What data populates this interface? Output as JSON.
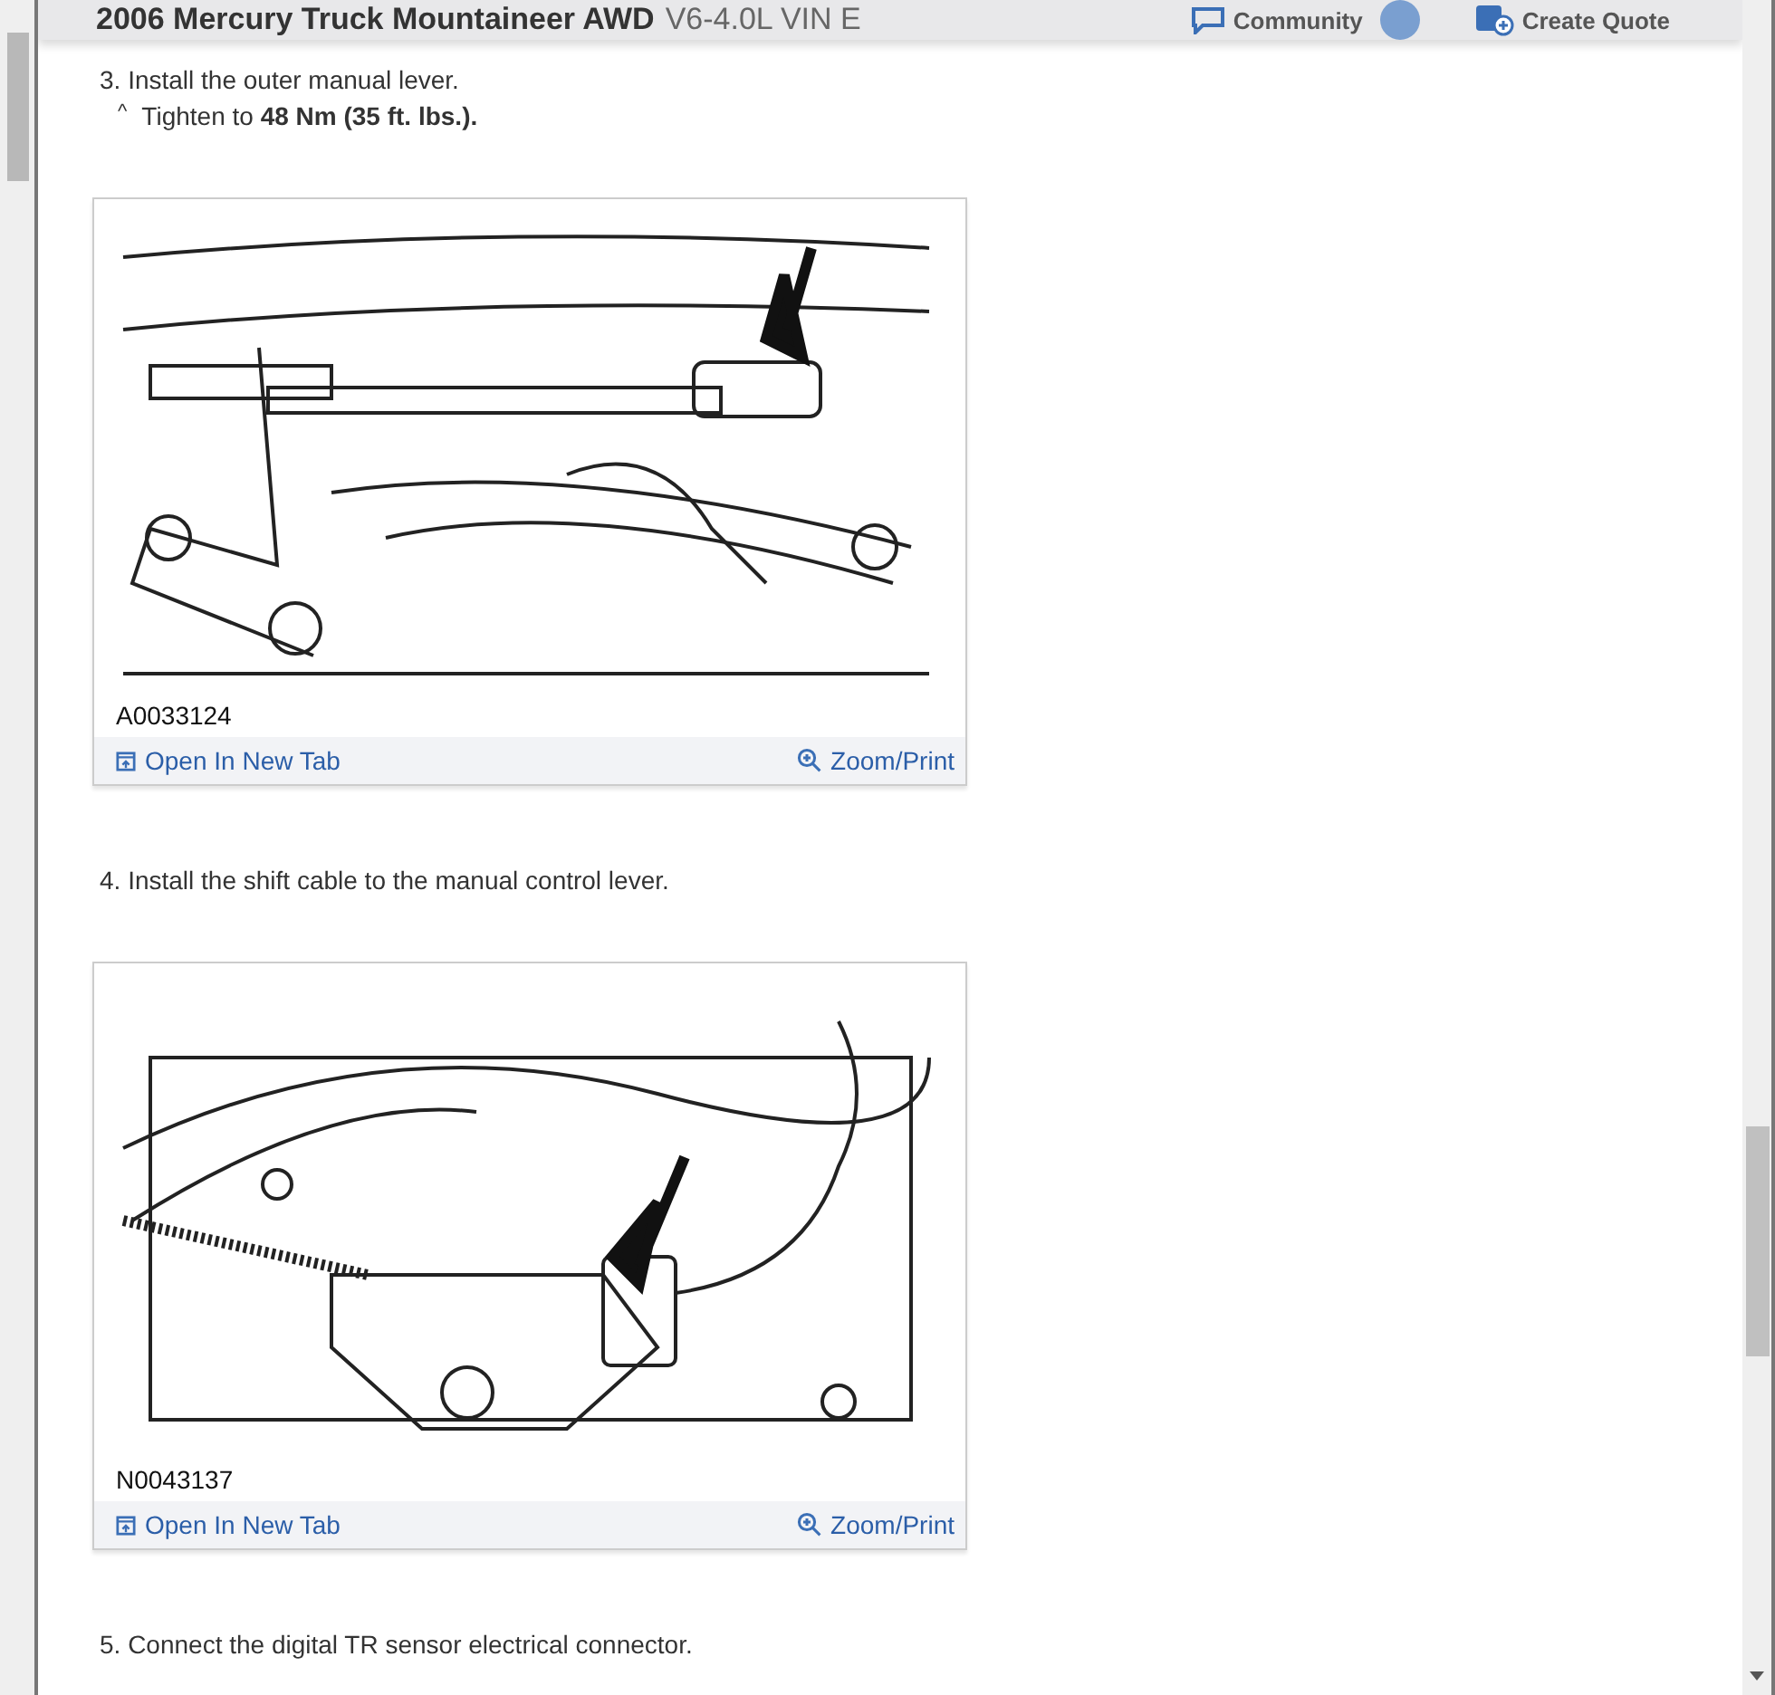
{
  "header": {
    "title": "2006 Mercury Truck Mountaineer AWD",
    "subtitle": "V6-4.0L VIN E",
    "community": {
      "label": "Community"
    },
    "create_quote": {
      "label": "Create Quote"
    }
  },
  "steps": [
    {
      "text": "3. Install the outer manual lever.",
      "note": {
        "mark": "^",
        "text": "Tighten to **48 Nm (35 ft. lbs.).**"
      },
      "figure": {
        "kind": "lever",
        "caption": "A0033124",
        "open_link": "Open In New Tab",
        "zoom_link": "Zoom/Print"
      }
    },
    {
      "text": "4. Install the shift cable to the manual control lever.",
      "figure": {
        "kind": "sensor",
        "caption": "N0043137",
        "open_link": "Open In New Tab",
        "zoom_link": "Zoom/Print"
      }
    },
    {
      "text": "5. Connect the digital TR sensor electrical connector."
    }
  ]
}
